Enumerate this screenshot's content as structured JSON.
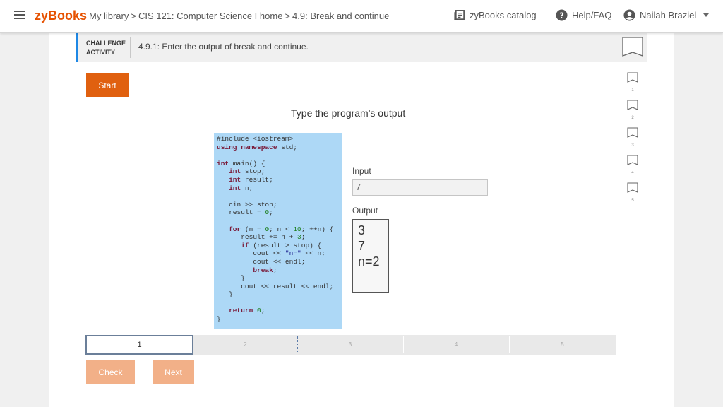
{
  "header": {
    "logo": "zyBooks",
    "breadcrumb": [
      "My library",
      ">",
      "CIS 121: Computer Science I home",
      ">",
      "4.9: Break and continue"
    ],
    "catalog_label": "zyBooks catalog",
    "help_label": "Help/FAQ",
    "user_name": "Nailah Braziel"
  },
  "activity": {
    "label_line1": "CHALLENGE",
    "label_line2": "ACTIVITY",
    "title": "4.9.1: Enter the output of break and continue.",
    "start_label": "Start",
    "prompt": "Type the program's output",
    "input_label": "Input",
    "input_value": "7",
    "output_label": "Output",
    "output_lines": [
      "3",
      "7",
      "n=2"
    ],
    "check_label": "Check",
    "next_label": "Next"
  },
  "code": {
    "include": "#include <iostream>",
    "using_kw": "using namespace",
    "using_rest": " std;",
    "main_kw": "int",
    "main_rest": " main() {",
    "decl1_kw": "int",
    "decl1_rest": " stop;",
    "decl2_kw": "int",
    "decl2_rest": " result;",
    "decl3_kw": "int",
    "decl3_rest": " n;",
    "cin": "cin >> stop;",
    "result_init_a": "result = ",
    "result_init_num": "0",
    "result_init_b": ";",
    "for_kw": "for",
    "for_a": " (n = ",
    "for_num1": "0",
    "for_b": "; n < ",
    "for_num2": "10",
    "for_c": "; ++n) {",
    "sum_a": "result += n + ",
    "sum_num": "3",
    "sum_b": ";",
    "if_kw": "if",
    "if_rest": " (result > stop) {",
    "cout1_a": "cout << ",
    "cout1_str": "\"n=\"",
    "cout1_b": " << n;",
    "cout2": "cout << endl;",
    "break_kw": "break",
    "break_rest": ";",
    "close_inner": "}",
    "cout3": "cout << result << endl;",
    "close_for": "}",
    "return_kw": "return",
    "return_num": "0",
    "return_end": ";",
    "close_main": "}"
  },
  "progress": {
    "segments": [
      "1",
      "2",
      "3",
      "4",
      "5"
    ],
    "active": 1
  },
  "levels": [
    "1",
    "2",
    "3",
    "4",
    "5"
  ]
}
